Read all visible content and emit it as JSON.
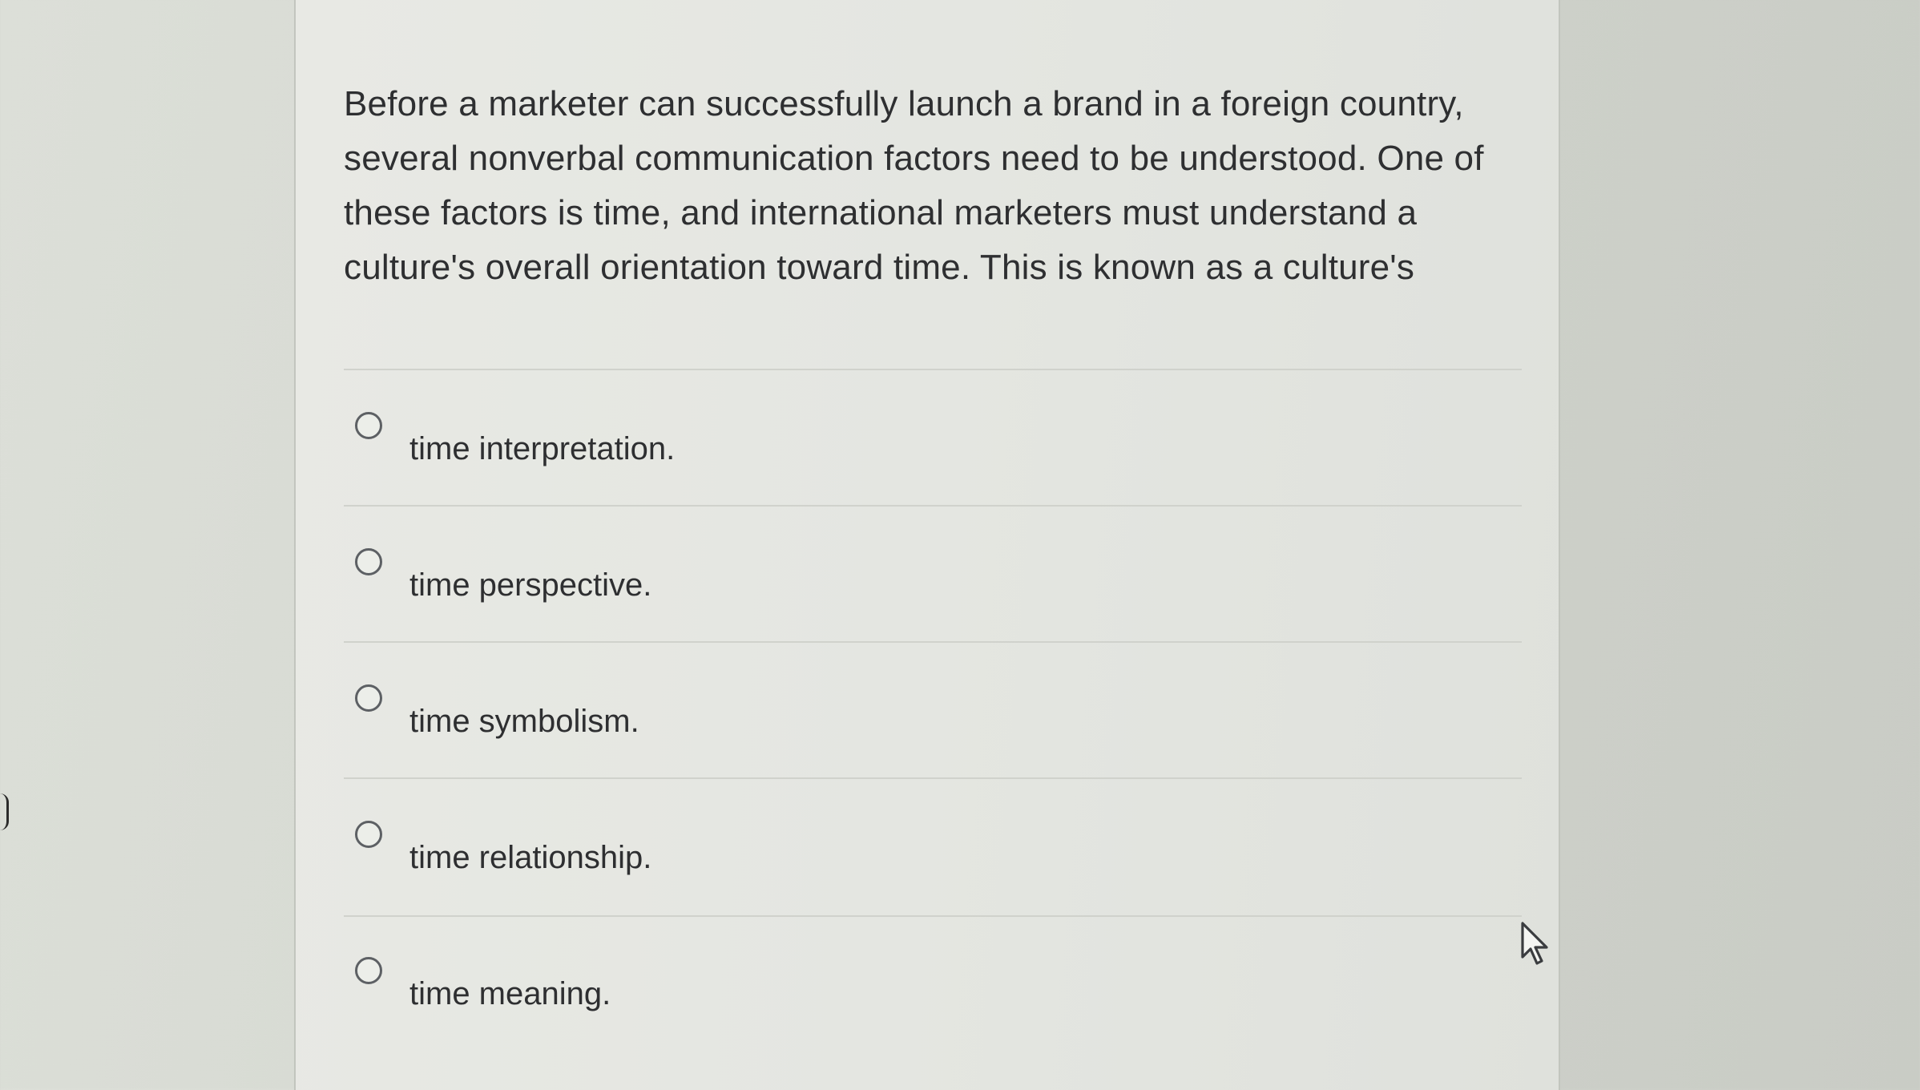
{
  "question": {
    "text": "Before a marketer can successfully launch a brand in a foreign country, several nonverbal communication factors need to be understood. One of these factors is time, and international marketers must understand a culture's overall orientation toward time. This is known as a culture's"
  },
  "options": [
    {
      "label": "time interpretation.",
      "selected": false
    },
    {
      "label": "time perspective.",
      "selected": false
    },
    {
      "label": "time symbolism.",
      "selected": false
    },
    {
      "label": "time relationship.",
      "selected": false
    },
    {
      "label": "time meaning.",
      "selected": false
    }
  ],
  "icons": {
    "radio": "radio-button-icon",
    "cursor": "mouse-pointer-icon"
  },
  "colors": {
    "text": "#2e2f31",
    "panel": "#e4e6e1",
    "background": "#d4d7d0",
    "radio_border": "#5d6064"
  }
}
